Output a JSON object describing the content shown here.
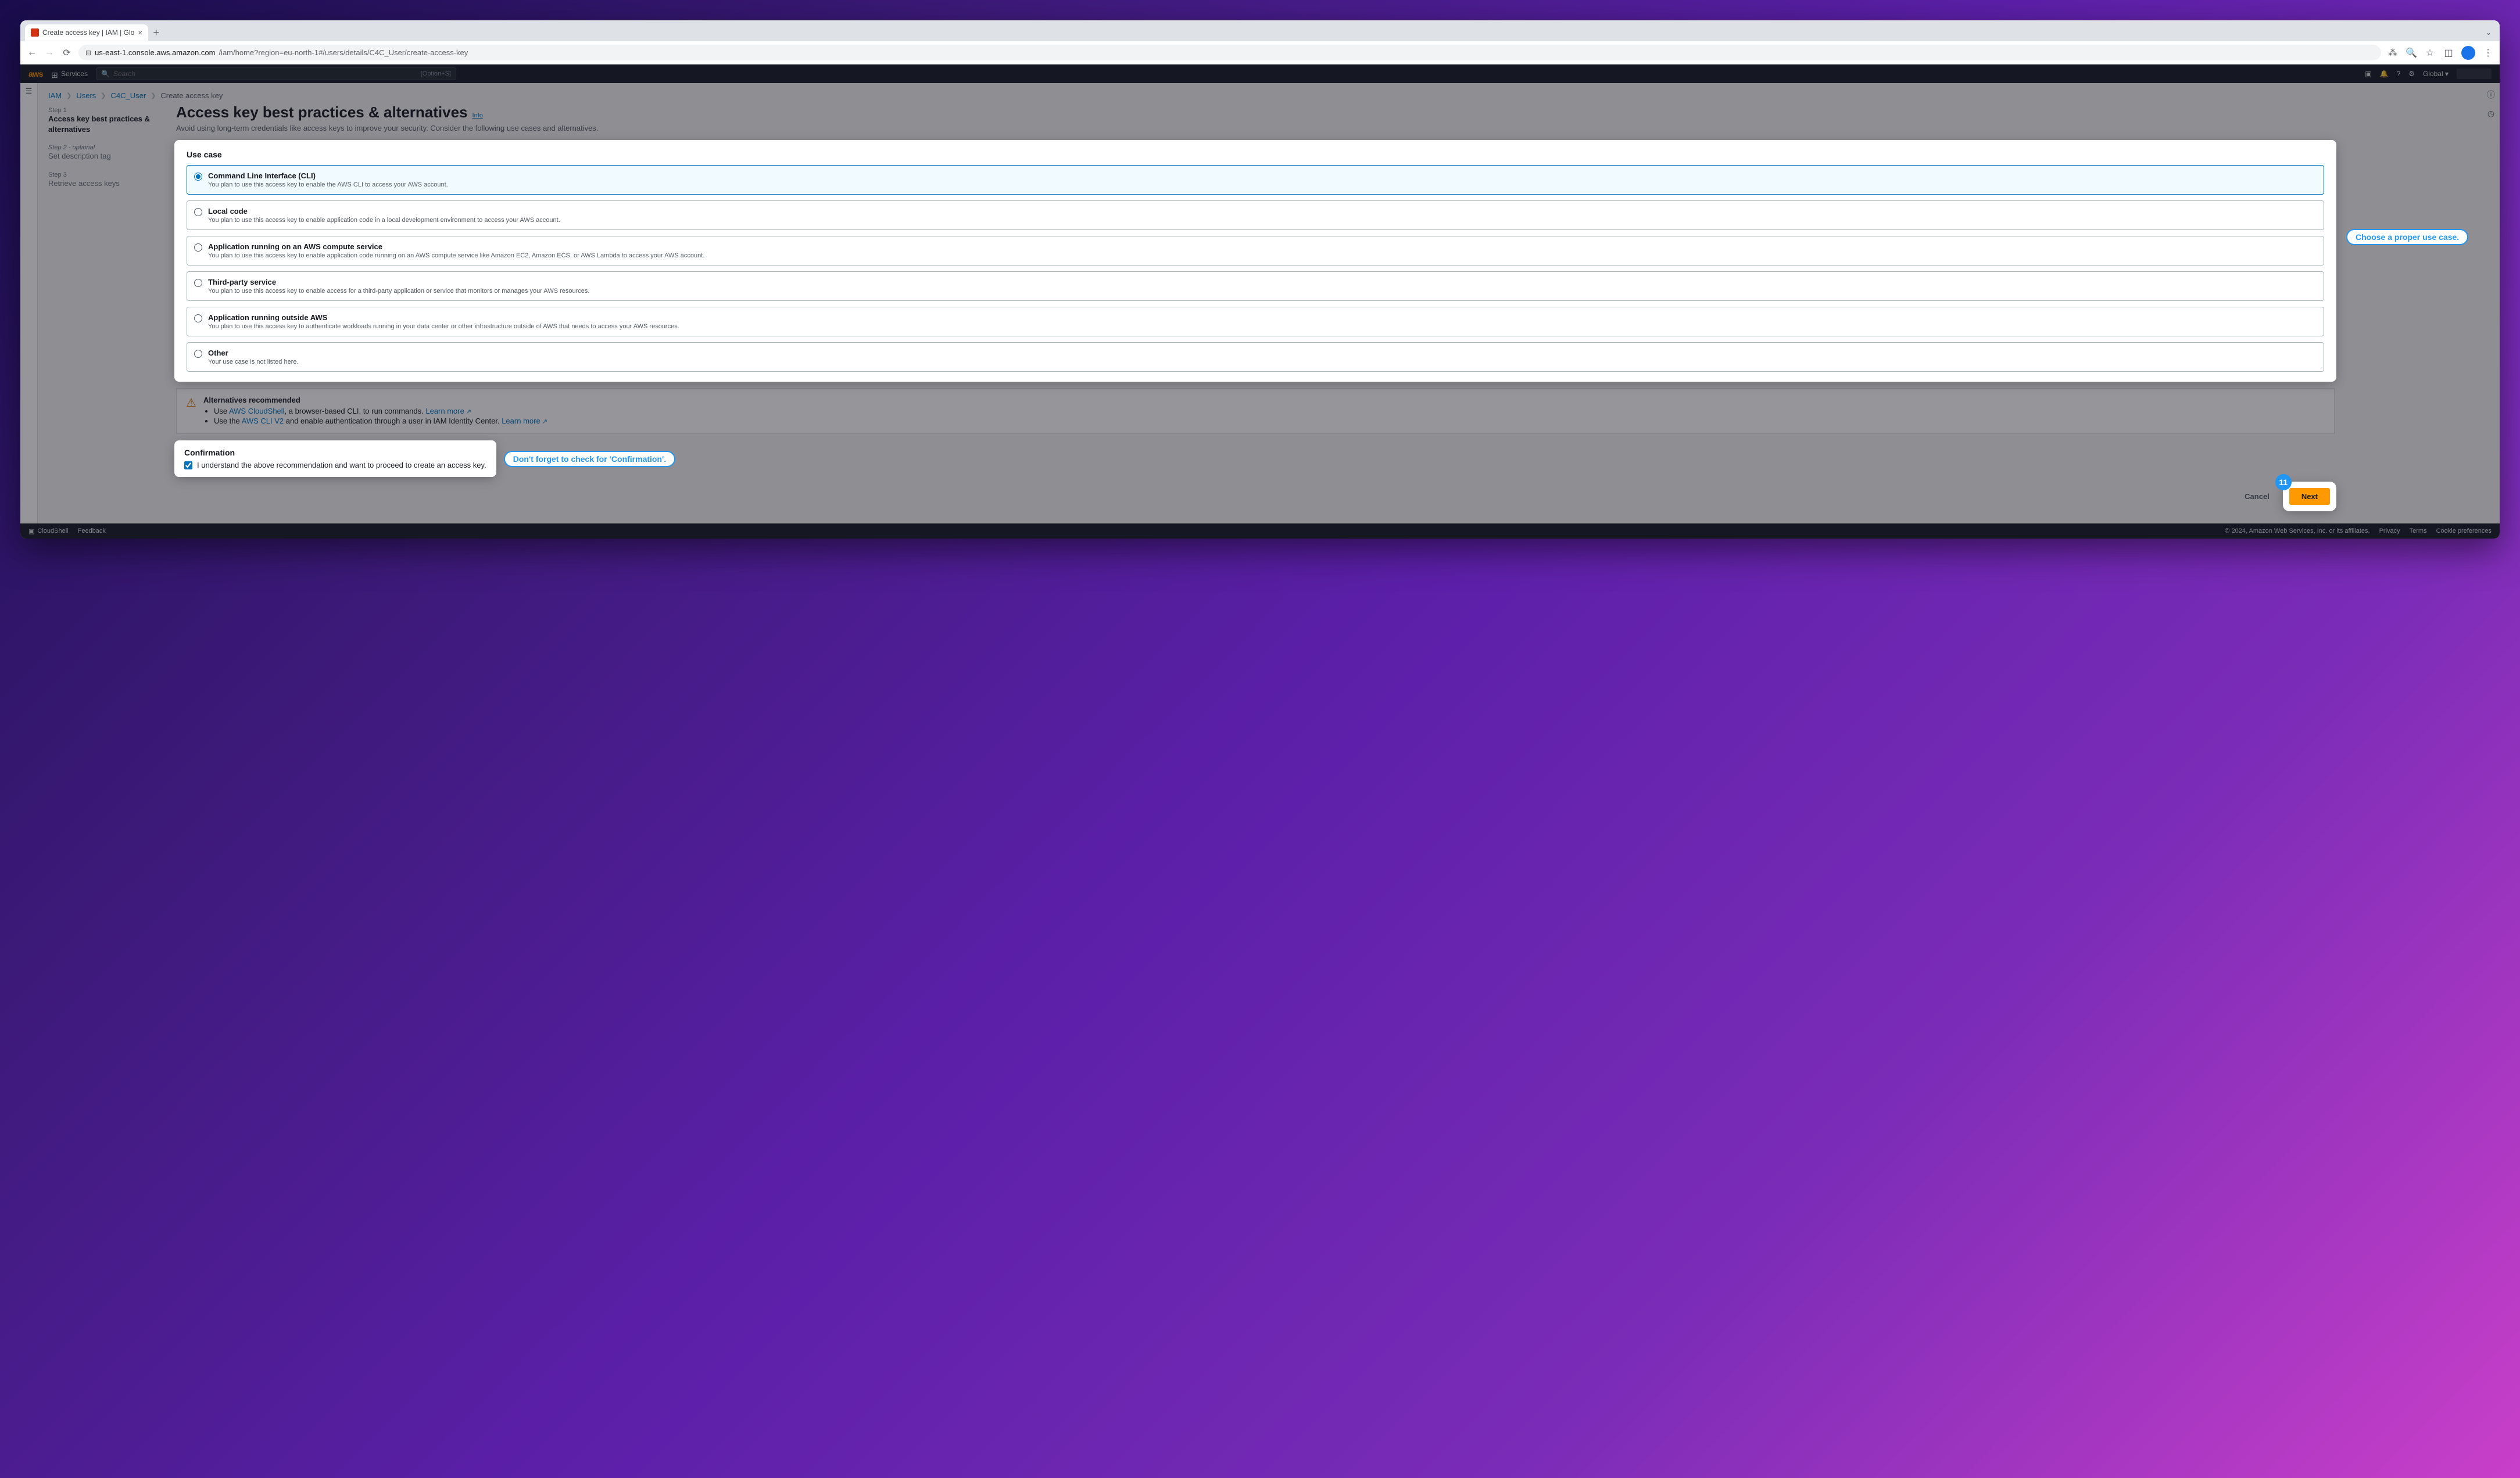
{
  "browser": {
    "tab_title": "Create access key | IAM | Glo",
    "url_host": "us-east-1.console.aws.amazon.com",
    "url_path": "/iam/home?region=eu-north-1#/users/details/C4C_User/create-access-key"
  },
  "aws_header": {
    "services": "Services",
    "search_placeholder": "Search",
    "shortcut": "[Option+S]",
    "region": "Global ▾"
  },
  "breadcrumbs": {
    "root": "IAM",
    "users": "Users",
    "user": "C4C_User",
    "current": "Create access key"
  },
  "steps": [
    {
      "num": "Step 1",
      "title": "Access key best practices & alternatives"
    },
    {
      "num": "Step 2 - optional",
      "title": "Set description tag"
    },
    {
      "num": "Step 3",
      "title": "Retrieve access keys"
    }
  ],
  "page": {
    "title": "Access key best practices & alternatives",
    "info": "Info",
    "subtitle": "Avoid using long-term credentials like access keys to improve your security. Consider the following use cases and alternatives."
  },
  "usecase": {
    "heading": "Use case",
    "options": [
      {
        "title": "Command Line Interface (CLI)",
        "desc": "You plan to use this access key to enable the AWS CLI to access your AWS account."
      },
      {
        "title": "Local code",
        "desc": "You plan to use this access key to enable application code in a local development environment to access your AWS account."
      },
      {
        "title": "Application running on an AWS compute service",
        "desc": "You plan to use this access key to enable application code running on an AWS compute service like Amazon EC2, Amazon ECS, or AWS Lambda to access your AWS account."
      },
      {
        "title": "Third-party service",
        "desc": "You plan to use this access key to enable access for a third-party application or service that monitors or manages your AWS resources."
      },
      {
        "title": "Application running outside AWS",
        "desc": "You plan to use this access key to authenticate workloads running in your data center or other infrastructure outside of AWS that needs to access your AWS resources."
      },
      {
        "title": "Other",
        "desc": "Your use case is not listed here."
      }
    ]
  },
  "alternatives": {
    "heading": "Alternatives recommended",
    "line1_prefix": "Use ",
    "line1_link": "AWS CloudShell",
    "line1_suffix": ", a browser-based CLI, to run commands. ",
    "learn_more": "Learn more",
    "line2_prefix": "Use the ",
    "line2_link": "AWS CLI V2",
    "line2_suffix": " and enable authentication through a user in IAM Identity Center. "
  },
  "confirmation": {
    "heading": "Confirmation",
    "label": "I understand the above recommendation and want to proceed to create an access key."
  },
  "actions": {
    "cancel": "Cancel",
    "next": "Next"
  },
  "footer": {
    "cloudshell": "CloudShell",
    "feedback": "Feedback",
    "copyright": "© 2024, Amazon Web Services, Inc. or its affiliates.",
    "privacy": "Privacy",
    "terms": "Terms",
    "cookies": "Cookie preferences"
  },
  "annotations": {
    "usecase_tip": "Choose a proper use case.",
    "confirm_tip": "Don't forget to check for 'Confirmation'.",
    "step_number": "11"
  }
}
